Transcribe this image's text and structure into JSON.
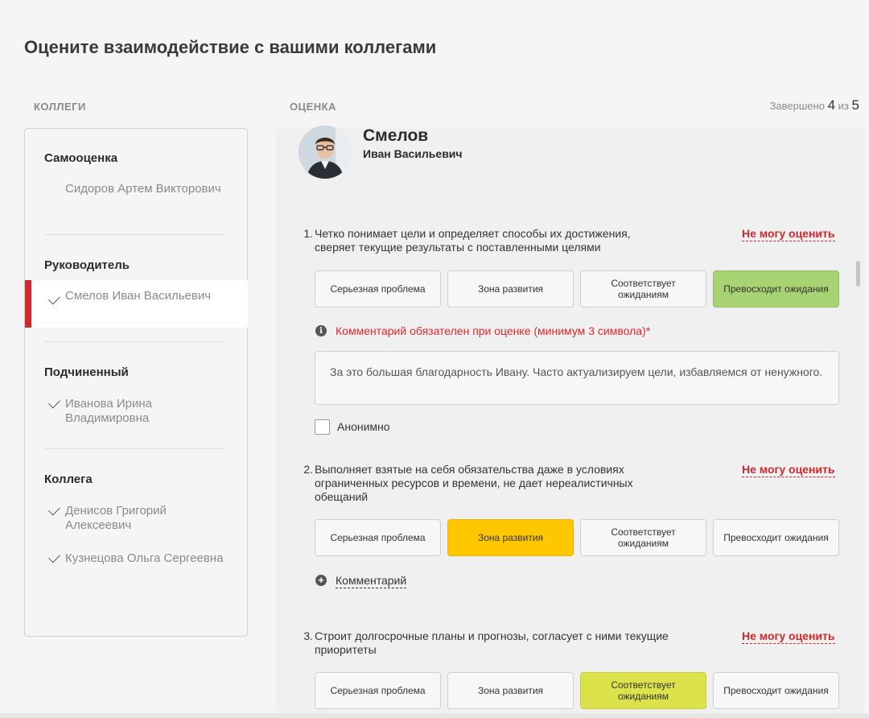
{
  "page": {
    "title": "Оцените взаимодействие с вашими коллегами",
    "colleagues_label": "КОЛЛЕГИ",
    "rating_label": "ОЦЕНКА",
    "progress": {
      "prefix": "Завершено",
      "done": "4",
      "sep": "из",
      "total": "5"
    }
  },
  "sidebar": {
    "groups": [
      {
        "title": "Самооценка",
        "people": [
          {
            "name": "Сидоров Артем Викторович",
            "done": false,
            "active": false
          }
        ]
      },
      {
        "title": "Руководитель",
        "people": [
          {
            "name": "Смелов Иван Васильевич",
            "done": true,
            "active": true
          }
        ]
      },
      {
        "title": "Подчиненный",
        "people": [
          {
            "name": "Иванова Ирина Владимировна",
            "done": true,
            "active": false
          }
        ]
      },
      {
        "title": "Коллега",
        "people": [
          {
            "name": "Денисов Григорий Алексеевич",
            "done": true,
            "active": false
          },
          {
            "name": "Кузнецова Ольга Сергеевна",
            "done": true,
            "active": false
          }
        ]
      }
    ]
  },
  "person": {
    "last_name": "Смелов",
    "first_name": "Иван Васильевич"
  },
  "rating_options": [
    "Серьезная проблема",
    "Зона развития",
    "Соответствует ожиданиям",
    "Превосходит ожидания"
  ],
  "questions": [
    {
      "num": "1.",
      "text": "Четко понимает цели и определяет способы их достижения, сверяет текущие результаты с поставленными целями",
      "cant_rate": "Не могу оценить",
      "selected": 3,
      "warning": "Комментарий обязателен при оценке (минимум 3 символа)*",
      "comment": "За это большая благодарность Ивану. Часто актуализируем цели, избавляемся от ненужного.",
      "anonymous_label": "Анонимно"
    },
    {
      "num": "2.",
      "text": "Выполняет взятые на себя обязательства даже в условиях ограниченных ресурсов и времени, не дает нереалистичных обещаний",
      "cant_rate": "Не могу оценить",
      "selected": 1,
      "add_comment": "Комментарий"
    },
    {
      "num": "3.",
      "text": "Строит долгосрочные планы и прогнозы, согласует с ними текущие приоритеты",
      "cant_rate": "Не могу оценить",
      "selected": 2
    }
  ],
  "colors": {
    "accent_red": "#d0282c",
    "green": "#a8d372",
    "yellow": "#ffc700",
    "lime": "#dce34a"
  }
}
